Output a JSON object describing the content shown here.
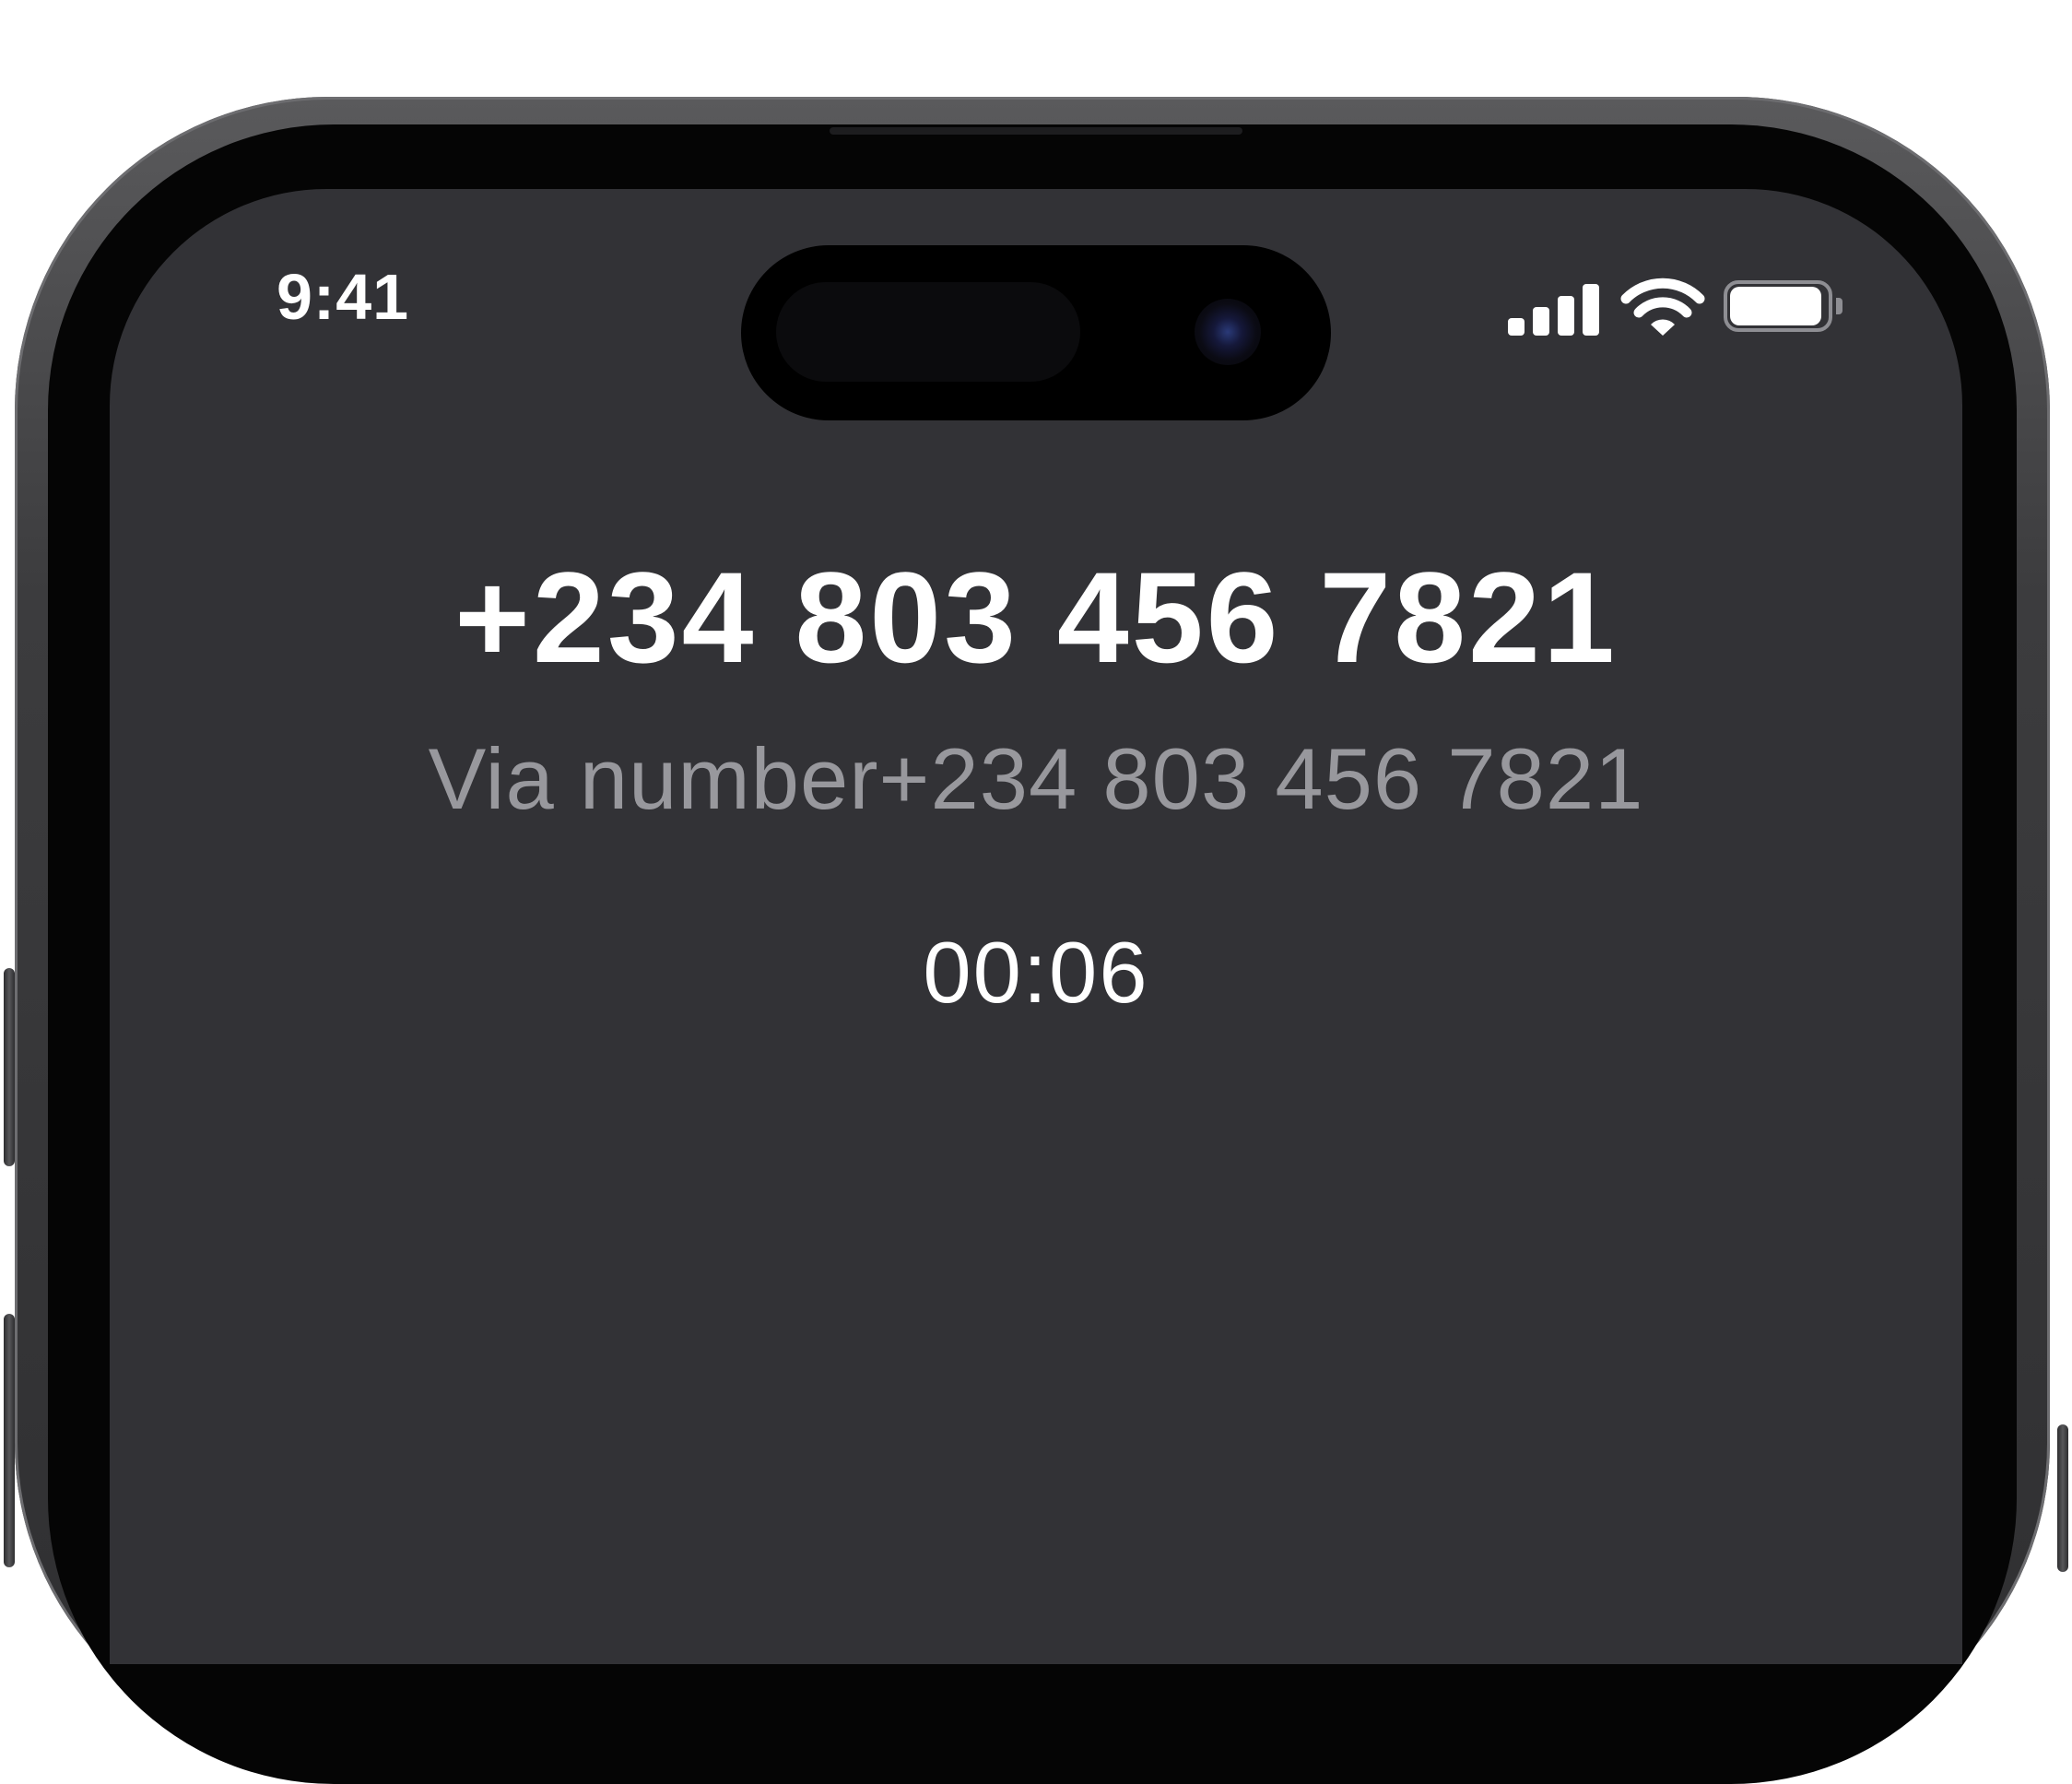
{
  "status_bar": {
    "time": "9:41",
    "cellular_icon": "cellular-signal-icon",
    "wifi_icon": "wifi-icon",
    "battery_icon": "battery-icon",
    "battery_level": 0.95
  },
  "call": {
    "number": "+234 803 456 7821",
    "via_label": "Via number+234 803 456 7821",
    "duration": "00:06"
  },
  "colors": {
    "screen_background": "#323236",
    "primary_text": "#ffffff",
    "secondary_text": "#98989d"
  }
}
